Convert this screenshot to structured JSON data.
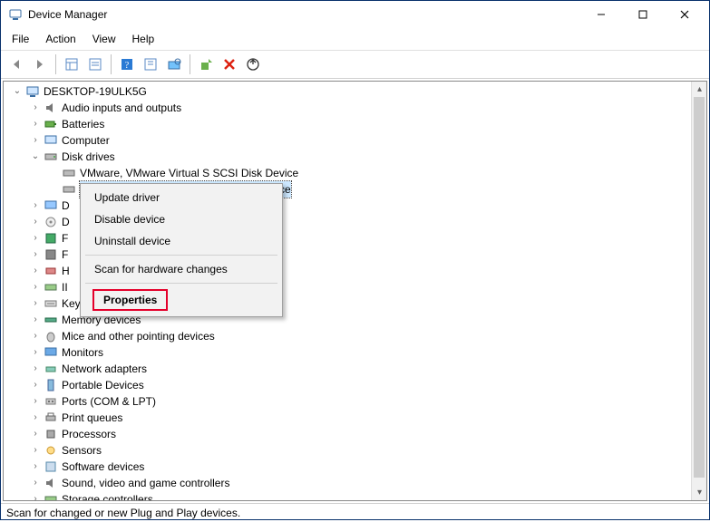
{
  "window": {
    "title": "Device Manager"
  },
  "menubar": {
    "file": "File",
    "action": "Action",
    "view": "View",
    "help": "Help"
  },
  "tree": {
    "root": "DESKTOP-19ULK5G",
    "audio": "Audio inputs and outputs",
    "batteries": "Batteries",
    "computer": "Computer",
    "diskdrives": "Disk drives",
    "disk1": "VMware, VMware Virtual S SCSI Disk Device",
    "disk2_tail": "ce",
    "displayadapters": "D",
    "dvdcd": "D",
    "floppy_ctrl": "F",
    "floppy_drv": "F",
    "hid": "H",
    "ide": "II",
    "keyboards": "Keyboards",
    "memory": "Memory devices",
    "mice": "Mice and other pointing devices",
    "monitors": "Monitors",
    "netadapters": "Network adapters",
    "portable": "Portable Devices",
    "ports": "Ports (COM & LPT)",
    "printq": "Print queues",
    "processors": "Processors",
    "sensors": "Sensors",
    "software": "Software devices",
    "sound": "Sound, video and game controllers",
    "storage": "Storage controllers"
  },
  "context_menu": {
    "update": "Update driver",
    "disable": "Disable device",
    "uninstall": "Uninstall device",
    "scan": "Scan for hardware changes",
    "properties": "Properties"
  },
  "statusbar": {
    "text": "Scan for changed or new Plug and Play devices."
  }
}
